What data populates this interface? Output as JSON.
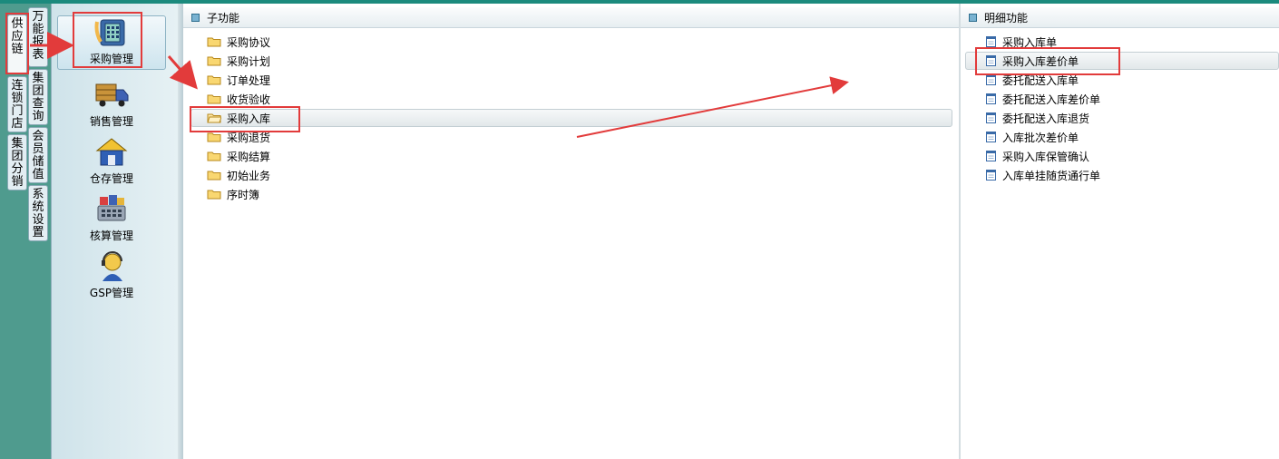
{
  "left_tabs": {
    "col1": [
      "供应链",
      "连锁门店",
      "集团分销"
    ],
    "col2": [
      "万能报表",
      "集团查询",
      "会员储值",
      "系统设置"
    ]
  },
  "modules": [
    {
      "label": "采购管理",
      "icon": "phone-calculator-icon"
    },
    {
      "label": "销售管理",
      "icon": "delivery-truck-icon"
    },
    {
      "label": "仓存管理",
      "icon": "warehouse-icon"
    },
    {
      "label": "核算管理",
      "icon": "cash-register-icon"
    },
    {
      "label": "GSP管理",
      "icon": "support-person-icon"
    }
  ],
  "subpane": {
    "title": "子功能",
    "items": [
      "采购协议",
      "采购计划",
      "订单处理",
      "收货验收",
      "采购入库",
      "采购退货",
      "采购结算",
      "初始业务",
      "序时簿"
    ]
  },
  "detailpane": {
    "title": "明细功能",
    "items": [
      "采购入库单",
      "采购入库差价单",
      "委托配送入库单",
      "委托配送入库差价单",
      "委托配送入库退货",
      "入库批次差价单",
      "采购入库保管确认",
      "入库单挂随货通行单"
    ]
  },
  "colors": {
    "accent": "#1b8a7d",
    "highlight": "#e23b3b"
  }
}
